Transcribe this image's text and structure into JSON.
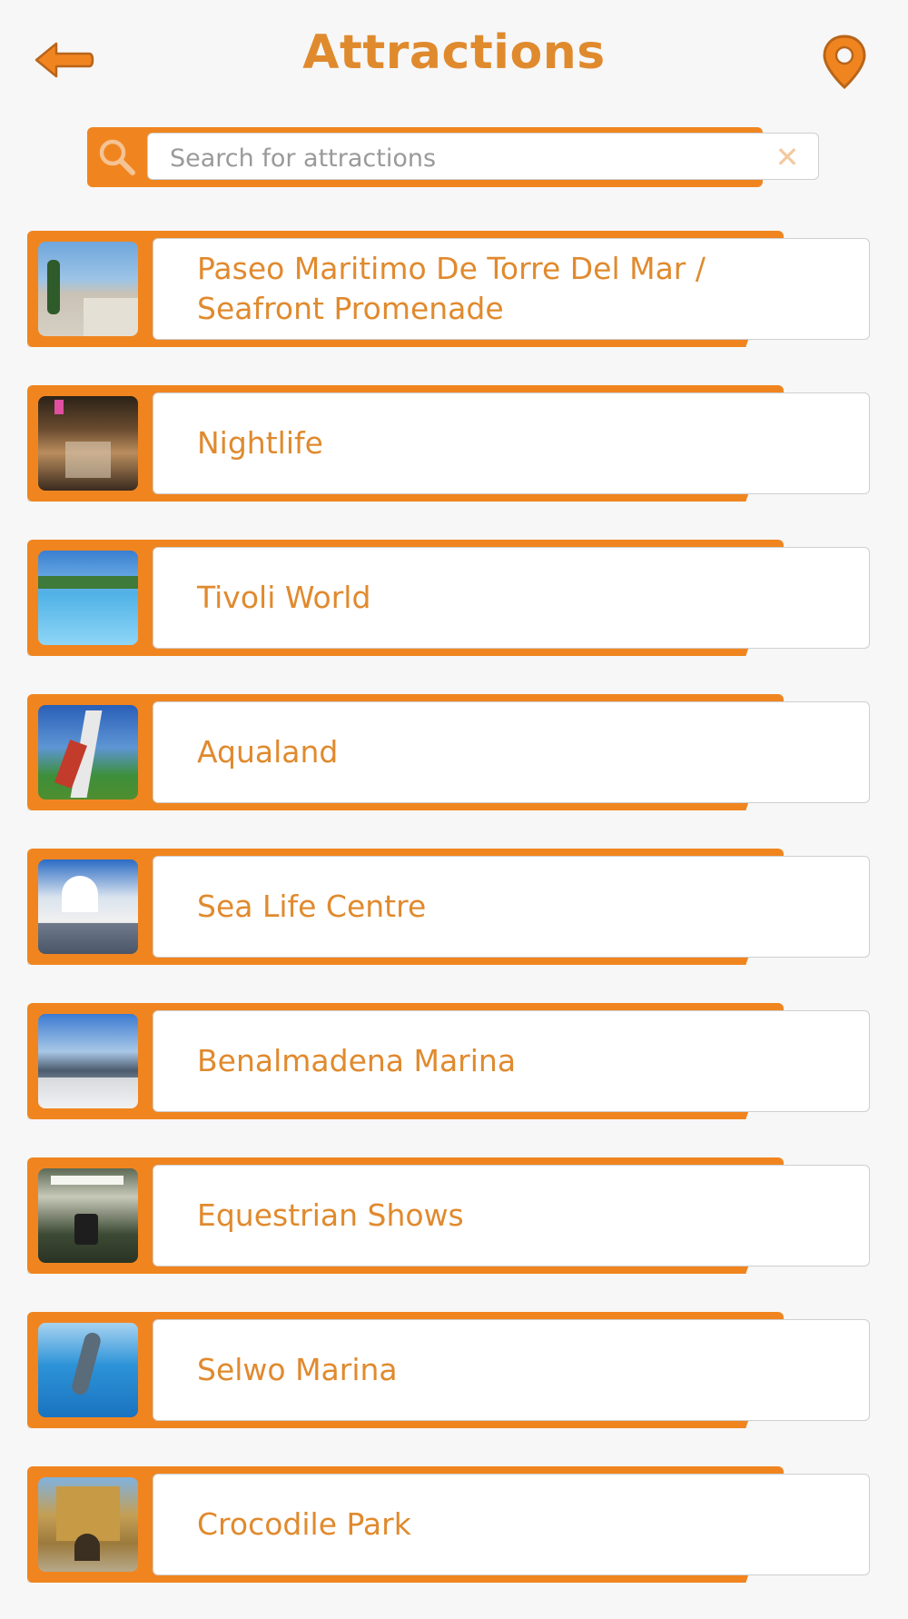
{
  "header": {
    "title": "Attractions",
    "back_icon": "back-arrow-icon",
    "location_icon": "map-pin-icon"
  },
  "search": {
    "placeholder": "Search for attractions",
    "value": "",
    "search_icon": "magnifier-icon",
    "clear_icon": "close-icon"
  },
  "colors": {
    "accent": "#f08520",
    "title_text": "#e08a2e",
    "background": "#f7f7f7"
  },
  "attractions": [
    {
      "label": "Paseo Maritimo De Torre Del Mar / Seafront Promenade"
    },
    {
      "label": "Nightlife"
    },
    {
      "label": "Tivoli World"
    },
    {
      "label": "Aqualand"
    },
    {
      "label": "Sea Life Centre"
    },
    {
      "label": "Benalmadena Marina"
    },
    {
      "label": "Equestrian Shows"
    },
    {
      "label": "Selwo Marina"
    },
    {
      "label": "Crocodile Park"
    }
  ]
}
